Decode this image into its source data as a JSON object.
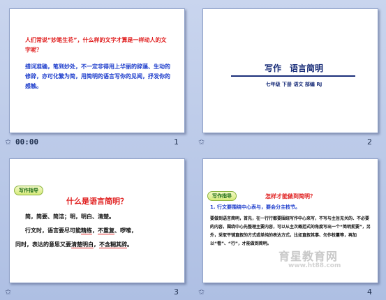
{
  "slides": [
    {
      "number": "1",
      "timing": "00:00",
      "question": "人们常说“妙笔生花”，什么样的文字才算是一样动人的文字呢？",
      "paragraph": "措词准确，笔到妙处，不一定非得用上华丽的辞藻、生动的修辞，亦可化繁为简，用简明的语言写你的见闻，抒发你的感触。"
    },
    {
      "number": "2",
      "title": "写作　语言简明",
      "subtitle": "七年级 下册 语文 部编 RJ"
    },
    {
      "number": "3",
      "badge": "写作指导",
      "title": "什么是语言简明？",
      "line1": "简，简要、简洁；明，明白、清楚。",
      "line2_prefix": "行文时，语言要尽可能",
      "line2_u1": "精练",
      "line2_sep": "，",
      "line2_u2": "不重复",
      "line2_suffix": "、啰嗦，",
      "line3_prefix": "同时，表达的意思又要",
      "line3_u1": "清楚明白",
      "line3_sep": "，",
      "line3_u2": "不含糊其辞",
      "line3_suffix": "。"
    },
    {
      "number": "4",
      "badge": "写作指导",
      "title": "怎样才能做到简明？",
      "heading": "1. 行文要围绕中心表与，要会分主枝节。",
      "paragraph": "要做到语言简明，首先，在一行行都要围绕写作中心来写，不写与主旨无关的、不必要的内容，围绕中心先整理主要内容，可以从主次概括式的角度写出一个“简明扼要”，另外，采取平铺直叙的方式或单纯的表达方式，比如直叙其事、勿作枝蔓等，再加以“看”、“行”，才能做到简明。"
    }
  ],
  "watermark": {
    "text": "育星教育网",
    "url": "www.ht88.com"
  }
}
